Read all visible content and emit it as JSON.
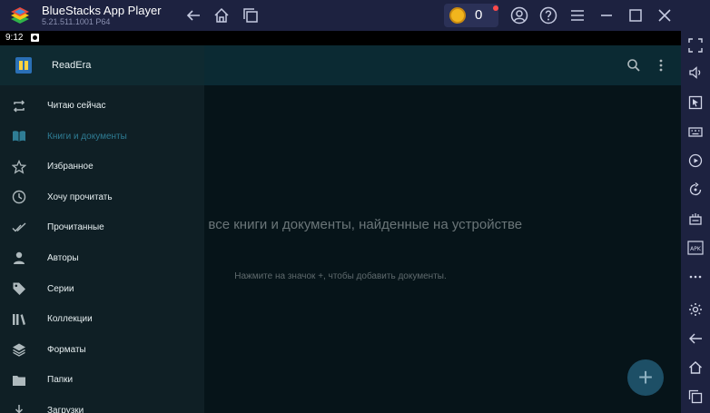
{
  "window": {
    "title": "BlueStacks App Player",
    "version": "5.21.511.1001 P64",
    "coin_count": "0"
  },
  "colors": {
    "titlebar": "#1d2240",
    "appbar": "#0b2a33",
    "drawer": "#0f1f25",
    "accent": "#2f7d95",
    "fab": "#1d4f66"
  },
  "status_bar": {
    "time": "9:12"
  },
  "app": {
    "name": "ReadEra"
  },
  "drawer": {
    "items": [
      {
        "label": "Читаю сейчас",
        "icon": "repeat-icon"
      },
      {
        "label": "Книги и документы",
        "icon": "book-icon",
        "active": true
      },
      {
        "label": "Избранное",
        "icon": "star-icon"
      },
      {
        "label": "Хочу прочитать",
        "icon": "clock-icon"
      },
      {
        "label": "Прочитанные",
        "icon": "double-check-icon"
      },
      {
        "label": "Авторы",
        "icon": "person-icon"
      },
      {
        "label": "Серии",
        "icon": "tag-icon"
      },
      {
        "label": "Коллекции",
        "icon": "library-icon"
      },
      {
        "label": "Форматы",
        "icon": "layers-icon"
      },
      {
        "label": "Папки",
        "icon": "folder-icon"
      },
      {
        "label": "Загрузки",
        "icon": "download-icon"
      }
    ]
  },
  "empty_state": {
    "title": "ь будут все книги и документы, найденные на устройстве",
    "hint": "Нажмите на значок +, чтобы добавить документы."
  },
  "fab": {
    "symbol": "+"
  }
}
